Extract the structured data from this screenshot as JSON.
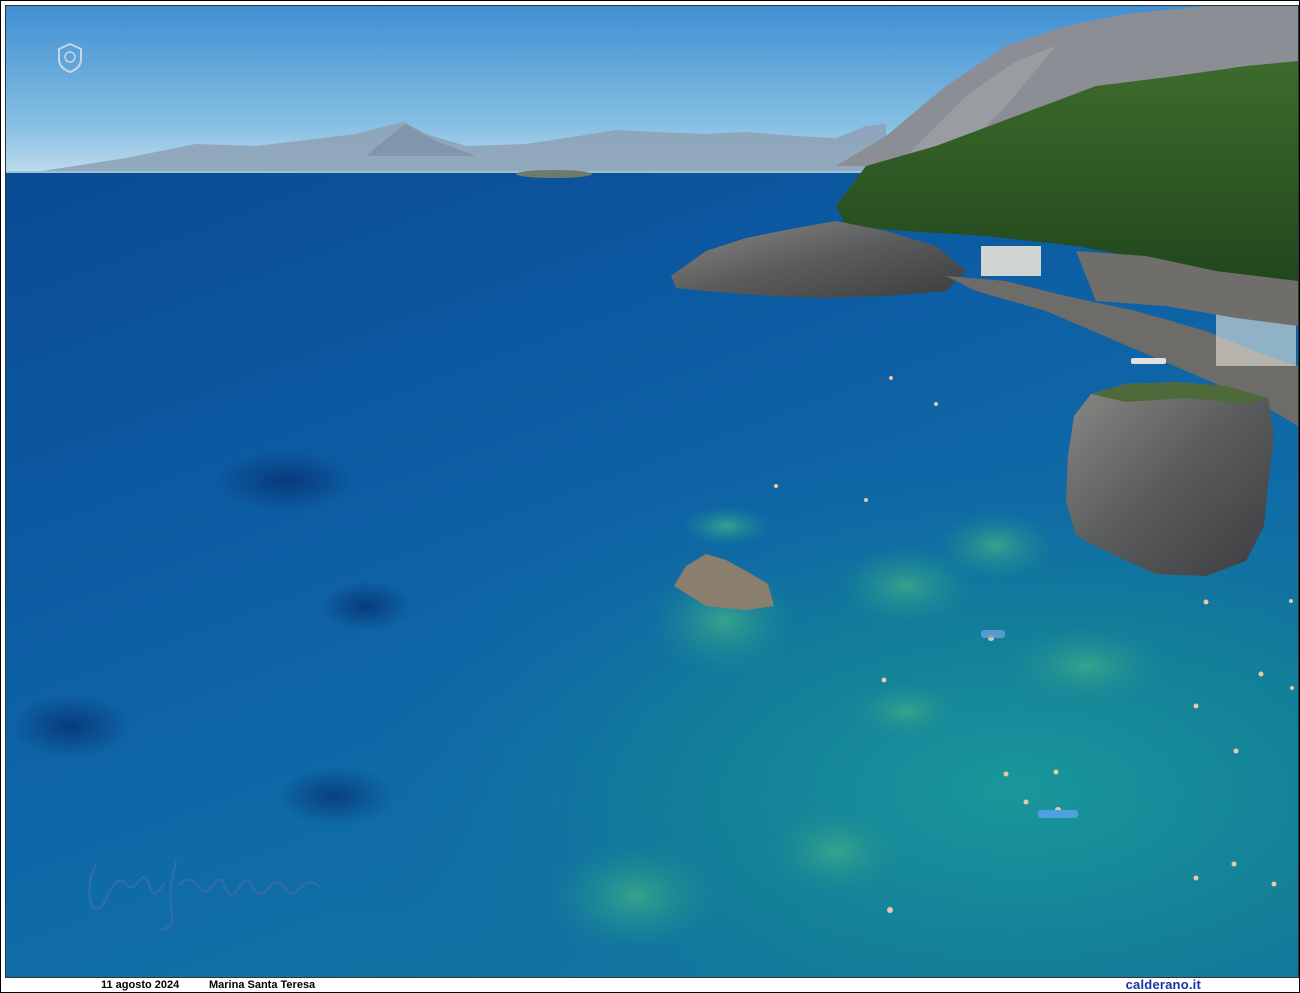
{
  "caption": {
    "date": "11 agosto 2024",
    "place": "Marina Santa Teresa",
    "site": "calderano.it"
  },
  "image": {
    "subject": "aerial-coastline-photo"
  },
  "colors": {
    "sky_top": "#4f9bd8",
    "sky_horizon": "#bcd8ea",
    "deep_sea": "#0a4f96",
    "mid_sea": "#0e64a8",
    "shallow_sea": "#168a9a",
    "reef": "#2a9a7e",
    "mountain_far": "#8ea6bd",
    "mountain_near": "#8a8f96",
    "forest": "#2e5a24",
    "rock": "#5e6064",
    "site_text": "#1a33a0"
  }
}
